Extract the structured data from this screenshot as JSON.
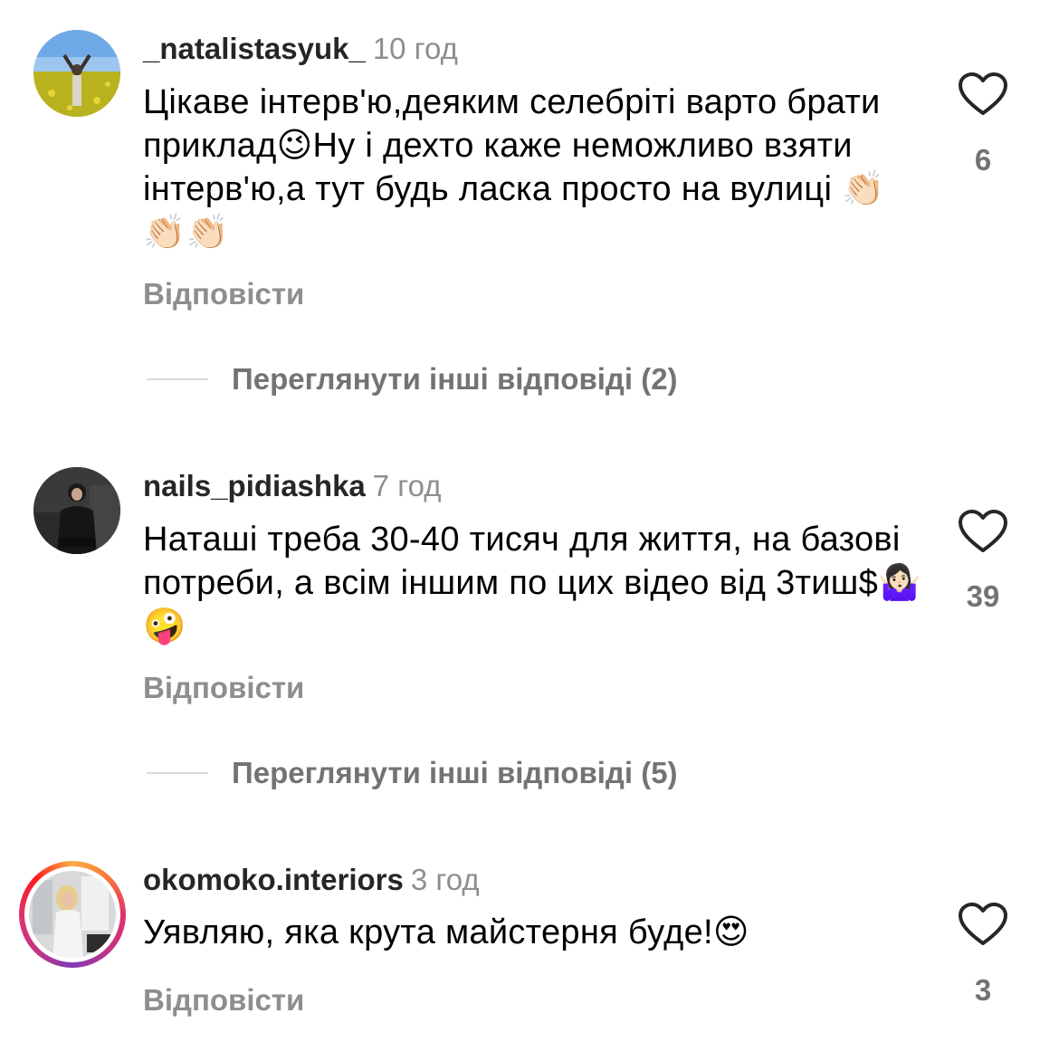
{
  "comments": [
    {
      "username": "_natalistasyuk_",
      "time": "10 год",
      "text": "Цікаве інтерв'ю,деяким селебріті варто брати приклад😉Ну і дехто каже неможливо взяти інтерв'ю,а тут будь ласка просто на вулиці 👏🏻👏🏻👏🏻",
      "reply_label": "Відповісти",
      "likes": "6",
      "view_replies": "Переглянути інші відповіді (2)"
    },
    {
      "username": "nails_pidiashka",
      "time": "7 год",
      "text": "Наташі треба 30-40 тисяч для життя, на базові потреби, а всім іншим по цих відео від 3тиш$🤷🏻‍♀️ 🤪",
      "reply_label": "Відповісти",
      "likes": "39",
      "view_replies": "Переглянути інші відповіді (5)"
    },
    {
      "username": "okomoko.interiors",
      "time": "3 год",
      "text": "Уявляю, яка крута майстерня буде!😍",
      "reply_label": "Відповісти",
      "likes": "3"
    }
  ],
  "icons": {
    "like": "heart-outline-icon"
  },
  "colors": {
    "text": "#000000",
    "username": "#262626",
    "muted": "#8e8e8e",
    "story_ring": "#e1306c"
  }
}
